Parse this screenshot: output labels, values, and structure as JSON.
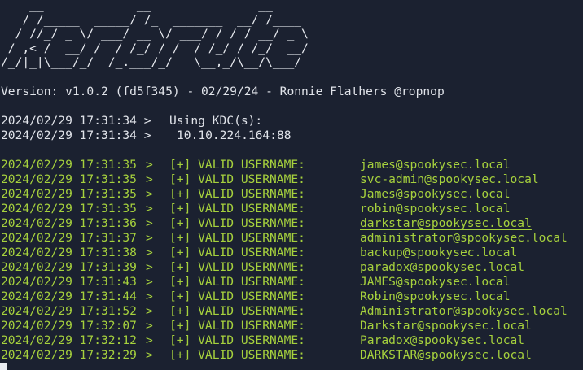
{
  "banner": {
    "art": "    __             __               __\n   / /_____  _____/ /_  _______  __/ /____\n  / //_/ _ \\/ ___/ __ \\/ ___/ / / / __/ _ \\\n / ,< /  __/ /  / /_/ / /  / /_/ / /_/  __/\n/_/|_|\\___/_/  /_.___/_/   \\__,_/\\__/\\___/"
  },
  "version_line": "Version: v1.0.2 (fd5f345) - 02/29/24 - Ronnie Flathers @ropnop",
  "kdc": {
    "ts1": "2024/02/29 17:31:34 >",
    "using_label": "Using KDC(s):",
    "ts2": "2024/02/29 17:31:34 >",
    "address": "10.10.224.164:88"
  },
  "results": [
    {
      "timestamp": "2024/02/29 17:31:35",
      "prompt": ">",
      "tag": "[+] VALID USERNAME:",
      "username": "james@spookysec.local"
    },
    {
      "timestamp": "2024/02/29 17:31:35",
      "prompt": ">",
      "tag": "[+] VALID USERNAME:",
      "username": "svc-admin@spookysec.local"
    },
    {
      "timestamp": "2024/02/29 17:31:35",
      "prompt": ">",
      "tag": "[+] VALID USERNAME:",
      "username": "James@spookysec.local"
    },
    {
      "timestamp": "2024/02/29 17:31:35",
      "prompt": ">",
      "tag": "[+] VALID USERNAME:",
      "username": "robin@spookysec.local"
    },
    {
      "timestamp": "2024/02/29 17:31:36",
      "prompt": ">",
      "tag": "[+] VALID USERNAME:",
      "username": "darkstar@spookysec.local"
    },
    {
      "timestamp": "2024/02/29 17:31:37",
      "prompt": ">",
      "tag": "[+] VALID USERNAME:",
      "username": "administrator@spookysec.local"
    },
    {
      "timestamp": "2024/02/29 17:31:38",
      "prompt": ">",
      "tag": "[+] VALID USERNAME:",
      "username": "backup@spookysec.local"
    },
    {
      "timestamp": "2024/02/29 17:31:39",
      "prompt": ">",
      "tag": "[+] VALID USERNAME:",
      "username": "paradox@spookysec.local"
    },
    {
      "timestamp": "2024/02/29 17:31:43",
      "prompt": ">",
      "tag": "[+] VALID USERNAME:",
      "username": "JAMES@spookysec.local"
    },
    {
      "timestamp": "2024/02/29 17:31:44",
      "prompt": ">",
      "tag": "[+] VALID USERNAME:",
      "username": "Robin@spookysec.local"
    },
    {
      "timestamp": "2024/02/29 17:31:52",
      "prompt": ">",
      "tag": "[+] VALID USERNAME:",
      "username": "Administrator@spookysec.local"
    },
    {
      "timestamp": "2024/02/29 17:32:07",
      "prompt": ">",
      "tag": "[+] VALID USERNAME:",
      "username": "Darkstar@spookysec.local"
    },
    {
      "timestamp": "2024/02/29 17:32:12",
      "prompt": ">",
      "tag": "[+] VALID USERNAME:",
      "username": "Paradox@spookysec.local"
    },
    {
      "timestamp": "2024/02/29 17:32:29",
      "prompt": ">",
      "tag": "[+] VALID USERNAME:",
      "username": "DARKSTAR@spookysec.local"
    }
  ],
  "colors": {
    "background": "#1b2130",
    "foreground": "#e1e4ea",
    "success": "#a6d13d"
  }
}
